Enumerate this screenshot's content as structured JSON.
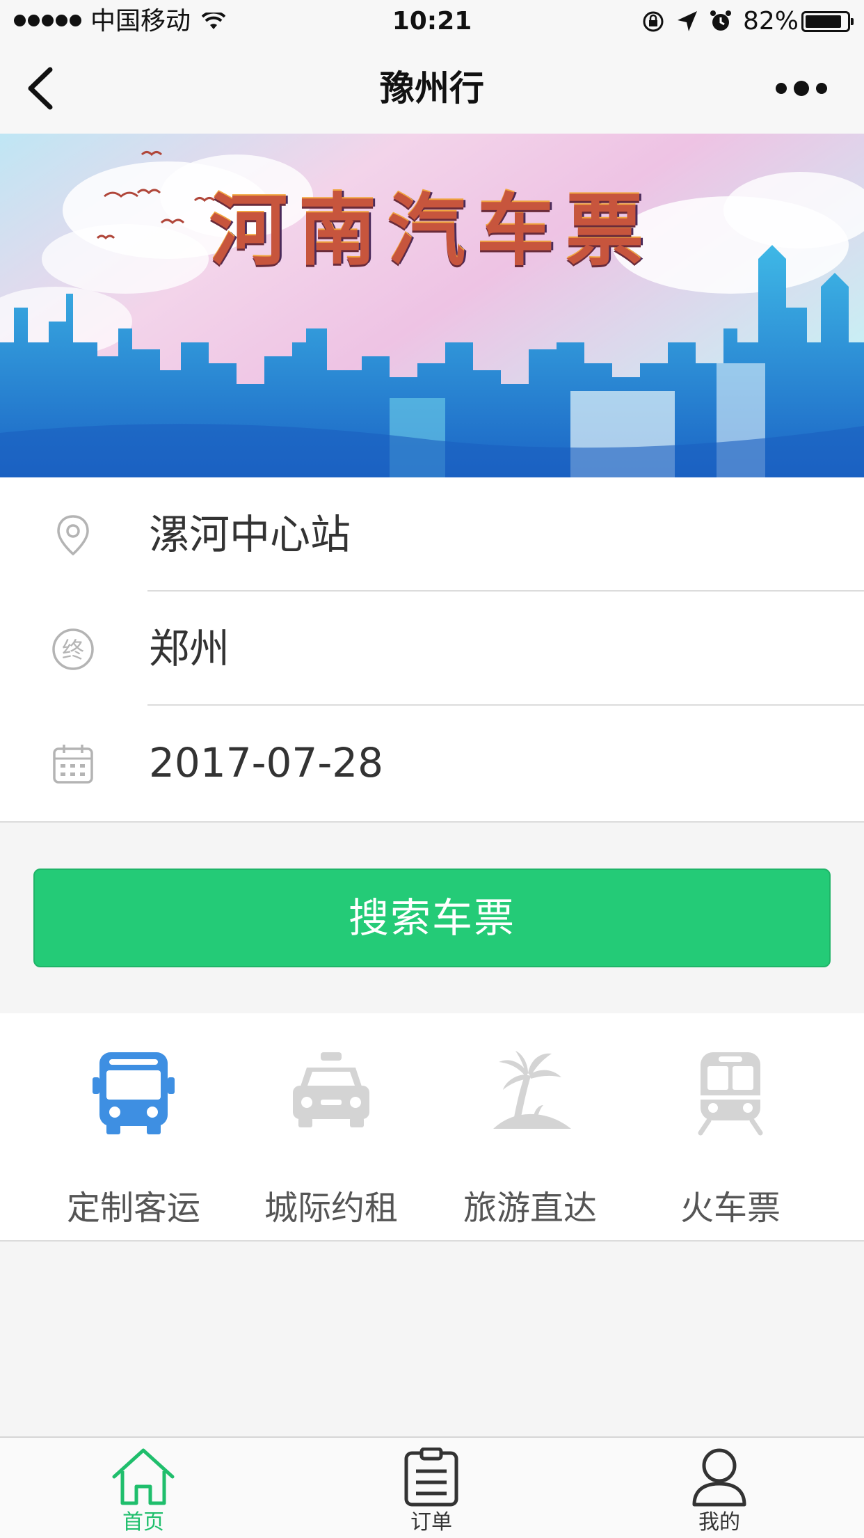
{
  "status_bar": {
    "carrier": "中国移动",
    "time": "10:21",
    "battery": "82%",
    "battery_level": 0.82
  },
  "nav": {
    "title": "豫州行",
    "back_icon": "chevron-left-icon",
    "more_icon": "more-dots-icon"
  },
  "banner": {
    "title": "河南汽车票"
  },
  "form": {
    "origin": "漯河中心站",
    "destination": "郑州",
    "destination_icon_glyph": "终",
    "date": "2017-07-28"
  },
  "search_button": {
    "label": "搜索车票",
    "color": "#24cb77"
  },
  "categories": [
    {
      "label": "定制客运",
      "icon": "bus-icon",
      "active": true
    },
    {
      "label": "城际约租",
      "icon": "taxi-icon",
      "active": false
    },
    {
      "label": "旅游直达",
      "icon": "palm-island-icon",
      "active": false
    },
    {
      "label": "火车票",
      "icon": "train-icon",
      "active": false
    }
  ],
  "tabbar": {
    "items": [
      {
        "label": "首页",
        "icon": "home-icon",
        "active": true
      },
      {
        "label": "订单",
        "icon": "clipboard-icon",
        "active": false
      },
      {
        "label": "我的",
        "icon": "user-icon",
        "active": false
      }
    ],
    "active_color": "#1fbe6c"
  }
}
